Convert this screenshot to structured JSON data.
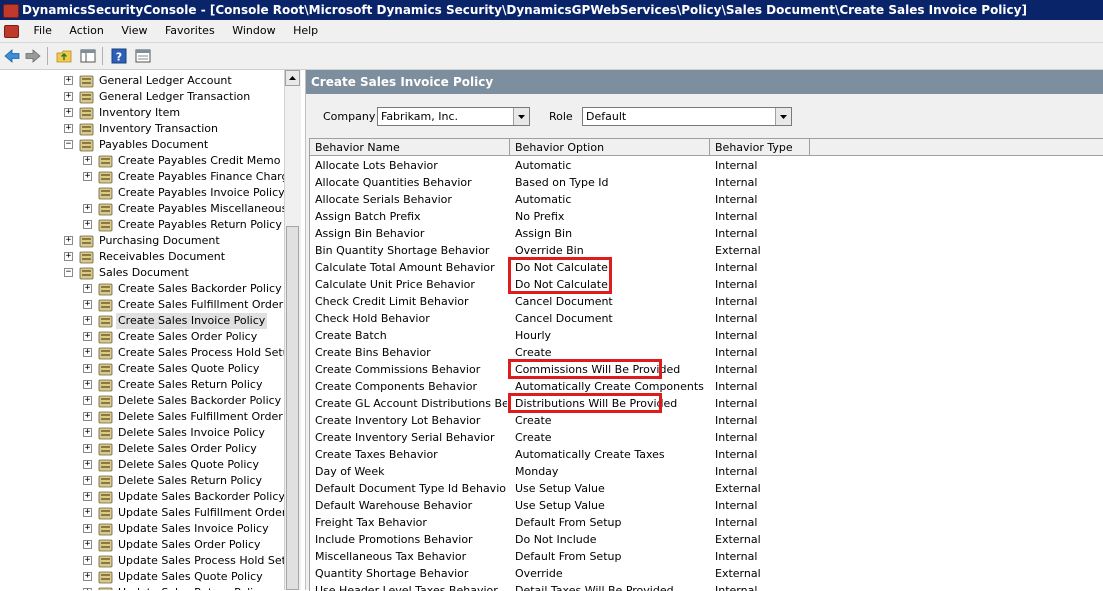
{
  "window": {
    "title": "DynamicsSecurityConsole - [Console Root\\Microsoft Dynamics Security\\DynamicsGPWebServices\\Policy\\Sales Document\\Create Sales Invoice Policy]"
  },
  "menu": [
    "File",
    "Action",
    "View",
    "Favorites",
    "Window",
    "Help"
  ],
  "toolbar": {
    "icons": [
      "back-arrow-icon",
      "forward-arrow-icon",
      "up-folder-icon",
      "show-hide-console-tree-icon",
      "help-icon",
      "properties-icon"
    ]
  },
  "tree": {
    "items": [
      {
        "label": "General Ledger Account",
        "level": 0,
        "expander": "+",
        "selected": false
      },
      {
        "label": "General Ledger Transaction",
        "level": 0,
        "expander": "+",
        "selected": false
      },
      {
        "label": "Inventory Item",
        "level": 0,
        "expander": "+",
        "selected": false
      },
      {
        "label": "Inventory Transaction",
        "level": 0,
        "expander": "+",
        "selected": false
      },
      {
        "label": "Payables Document",
        "level": 0,
        "expander": "-",
        "selected": false
      },
      {
        "label": "Create Payables Credit Memo Polic",
        "level": 1,
        "expander": "+",
        "selected": false
      },
      {
        "label": "Create Payables Finance Charge F",
        "level": 1,
        "expander": "+",
        "selected": false
      },
      {
        "label": "Create Payables Invoice Policy",
        "level": 1,
        "expander": "",
        "selected": false
      },
      {
        "label": "Create Payables Miscellaneous Cha",
        "level": 1,
        "expander": "+",
        "selected": false
      },
      {
        "label": "Create Payables Return Policy",
        "level": 1,
        "expander": "+",
        "selected": false
      },
      {
        "label": "Purchasing Document",
        "level": 0,
        "expander": "+",
        "selected": false
      },
      {
        "label": "Receivables Document",
        "level": 0,
        "expander": "+",
        "selected": false
      },
      {
        "label": "Sales Document",
        "level": 0,
        "expander": "-",
        "selected": false
      },
      {
        "label": "Create Sales Backorder Policy",
        "level": 1,
        "expander": "+",
        "selected": false
      },
      {
        "label": "Create Sales Fulfillment Order Polic",
        "level": 1,
        "expander": "+",
        "selected": false
      },
      {
        "label": "Create Sales Invoice Policy",
        "level": 1,
        "expander": "+",
        "selected": true
      },
      {
        "label": "Create Sales Order Policy",
        "level": 1,
        "expander": "+",
        "selected": false
      },
      {
        "label": "Create Sales Process Hold Setup P",
        "level": 1,
        "expander": "+",
        "selected": false
      },
      {
        "label": "Create Sales Quote Policy",
        "level": 1,
        "expander": "+",
        "selected": false
      },
      {
        "label": "Create Sales Return Policy",
        "level": 1,
        "expander": "+",
        "selected": false
      },
      {
        "label": "Delete Sales Backorder Policy",
        "level": 1,
        "expander": "+",
        "selected": false
      },
      {
        "label": "Delete Sales Fulfillment Order Polic",
        "level": 1,
        "expander": "+",
        "selected": false
      },
      {
        "label": "Delete Sales Invoice Policy",
        "level": 1,
        "expander": "+",
        "selected": false
      },
      {
        "label": "Delete Sales Order Policy",
        "level": 1,
        "expander": "+",
        "selected": false
      },
      {
        "label": "Delete Sales Quote Policy",
        "level": 1,
        "expander": "+",
        "selected": false
      },
      {
        "label": "Delete Sales Return Policy",
        "level": 1,
        "expander": "+",
        "selected": false
      },
      {
        "label": "Update Sales Backorder Policy",
        "level": 1,
        "expander": "+",
        "selected": false
      },
      {
        "label": "Update Sales Fulfillment Order Poli",
        "level": 1,
        "expander": "+",
        "selected": false
      },
      {
        "label": "Update Sales Invoice Policy",
        "level": 1,
        "expander": "+",
        "selected": false
      },
      {
        "label": "Update Sales Order Policy",
        "level": 1,
        "expander": "+",
        "selected": false
      },
      {
        "label": "Update Sales Process Hold Setup P",
        "level": 1,
        "expander": "+",
        "selected": false
      },
      {
        "label": "Update Sales Quote Policy",
        "level": 1,
        "expander": "+",
        "selected": false
      },
      {
        "label": "Update Sales Return Policy",
        "level": 1,
        "expander": "+",
        "selected": false
      }
    ]
  },
  "pane": {
    "title": "Create Sales Invoice Policy",
    "company_label": "Company",
    "company_value": "Fabrikam, Inc.",
    "role_label": "Role",
    "role_value": "Default"
  },
  "grid": {
    "columns": [
      "Behavior Name",
      "Behavior Option",
      "Behavior Type"
    ],
    "rows": [
      [
        "Allocate Lots Behavior",
        "Automatic",
        "Internal"
      ],
      [
        "Allocate Quantities Behavior",
        "Based on Type Id",
        "Internal"
      ],
      [
        "Allocate Serials Behavior",
        "Automatic",
        "Internal"
      ],
      [
        "Assign Batch Prefix",
        "No Prefix",
        "Internal"
      ],
      [
        "Assign Bin Behavior",
        "Assign Bin",
        "Internal"
      ],
      [
        "Bin Quantity Shortage Behavior",
        "Override Bin",
        "External"
      ],
      [
        "Calculate Total Amount Behavior",
        "Do Not Calculate",
        "Internal"
      ],
      [
        "Calculate Unit Price Behavior",
        "Do Not Calculate",
        "Internal"
      ],
      [
        "Check Credit Limit Behavior",
        "Cancel Document",
        "Internal"
      ],
      [
        "Check Hold Behavior",
        "Cancel Document",
        "Internal"
      ],
      [
        "Create Batch",
        "Hourly",
        "Internal"
      ],
      [
        "Create Bins Behavior",
        "Create",
        "Internal"
      ],
      [
        "Create Commissions Behavior",
        "Commissions Will Be Provided",
        "Internal"
      ],
      [
        "Create Components Behavior",
        "Automatically Create Components",
        "Internal"
      ],
      [
        "Create GL Account Distributions Beha...",
        "Distributions Will Be Provided",
        "Internal"
      ],
      [
        "Create Inventory Lot Behavior",
        "Create",
        "Internal"
      ],
      [
        "Create Inventory Serial Behavior",
        "Create",
        "Internal"
      ],
      [
        "Create Taxes Behavior",
        "Automatically Create Taxes",
        "Internal"
      ],
      [
        "Day of Week",
        "Monday",
        "Internal"
      ],
      [
        "Default Document Type Id Behavior",
        "Use Setup Value",
        "External"
      ],
      [
        "Default Warehouse Behavior",
        "Use Setup Value",
        "Internal"
      ],
      [
        "Freight Tax Behavior",
        "Default From Setup",
        "Internal"
      ],
      [
        "Include Promotions Behavior",
        "Do Not Include",
        "External"
      ],
      [
        "Miscellaneous Tax Behavior",
        "Default From Setup",
        "Internal"
      ],
      [
        "Quantity Shortage Behavior",
        "Override",
        "External"
      ],
      [
        "Use Header Level Taxes Behavior",
        "Detail Taxes Will Be Provided",
        "Internal"
      ]
    ],
    "highlighted_row_groups": [
      [
        6,
        7
      ],
      [
        12
      ],
      [
        14
      ]
    ],
    "highlight_color": "#e01b1b"
  },
  "colors": {
    "title_bar": "#0a246a",
    "pane_header": "#7d8e9e",
    "chrome": "#f0f0f0"
  }
}
